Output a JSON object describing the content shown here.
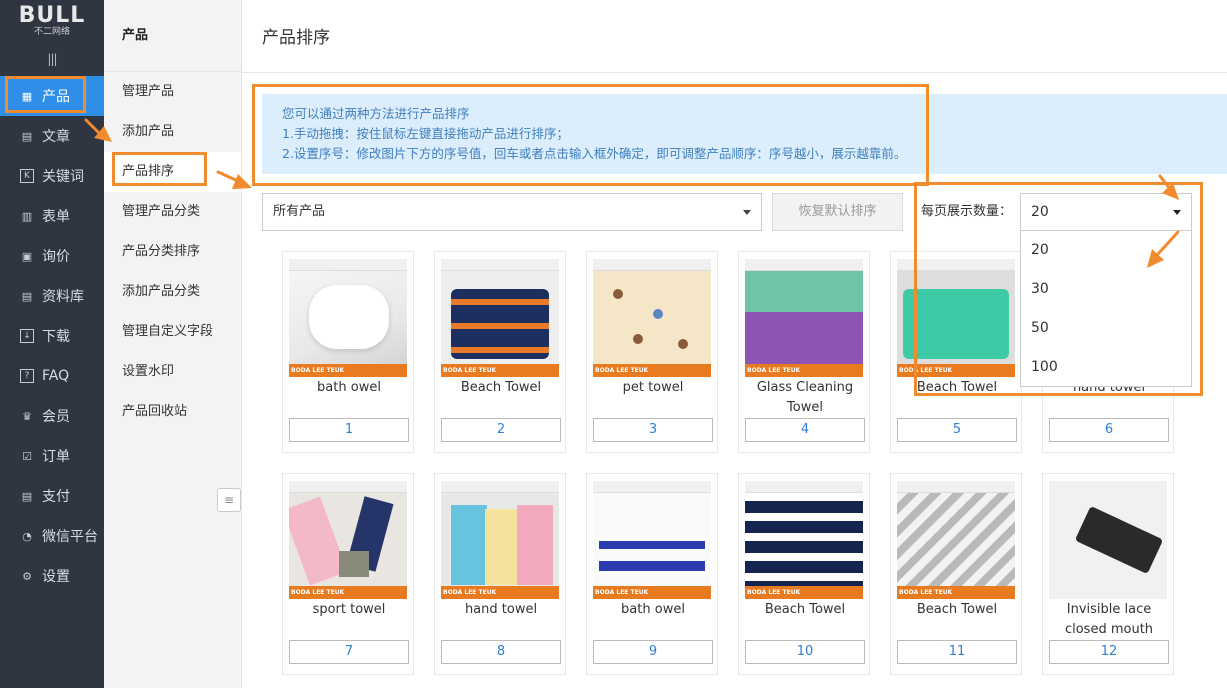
{
  "logo": {
    "brand": "BULL",
    "sub": "不二网络"
  },
  "sidebar": {
    "collapse_glyph": "|||",
    "items": [
      {
        "label": "产品",
        "icon": "grid-icon",
        "glyph": "▦",
        "active": true
      },
      {
        "label": "文章",
        "icon": "document-icon",
        "glyph": "▤"
      },
      {
        "label": "关键词",
        "icon": "keyword-icon",
        "glyph": "K"
      },
      {
        "label": "表单",
        "icon": "form-icon",
        "glyph": "▥"
      },
      {
        "label": "询价",
        "icon": "inquiry-icon",
        "glyph": "▣"
      },
      {
        "label": "资料库",
        "icon": "database-icon",
        "glyph": "▤"
      },
      {
        "label": "下载",
        "icon": "download-icon",
        "glyph": "↓"
      },
      {
        "label": "FAQ",
        "icon": "question-icon",
        "glyph": "?"
      },
      {
        "label": "会员",
        "icon": "crown-icon",
        "glyph": "♛"
      },
      {
        "label": "订单",
        "icon": "order-icon",
        "glyph": "☑"
      },
      {
        "label": "支付",
        "icon": "payment-icon",
        "glyph": "▤"
      },
      {
        "label": "微信平台",
        "icon": "wechat-icon",
        "glyph": "◔"
      },
      {
        "label": "设置",
        "icon": "gear-icon",
        "glyph": "⚙"
      }
    ]
  },
  "submenu": {
    "title": "产品",
    "toggle_glyph": "≡",
    "items": [
      {
        "label": "管理产品"
      },
      {
        "label": "添加产品"
      },
      {
        "label": "产品排序",
        "active": true
      },
      {
        "label": "管理产品分类"
      },
      {
        "label": "产品分类排序"
      },
      {
        "label": "添加产品分类"
      },
      {
        "label": "管理自定义字段"
      },
      {
        "label": "设置水印"
      },
      {
        "label": "产品回收站"
      }
    ]
  },
  "page": {
    "title": "产品排序"
  },
  "tip": {
    "line1": "您可以通过两种方法进行产品排序",
    "line2": "1.手动拖拽：按住鼠标左键直接拖动产品进行排序；",
    "line3": "2.设置序号：修改图片下方的序号值，回车或者点击输入框外确定，即可调整产品顺序：序号越小，展示越靠前。"
  },
  "filter": {
    "value": "所有产品"
  },
  "reset_button": "恢复默认排序",
  "per_page": {
    "label": "每页展示数量：",
    "value": "20",
    "options": [
      "20",
      "30",
      "50",
      "100"
    ]
  },
  "products": [
    {
      "name": "bath owel",
      "seq": "1",
      "brand_label": "BODA LEE TEUK"
    },
    {
      "name": "Beach Towel",
      "seq": "2",
      "brand_label": "BODA LEE TEUK"
    },
    {
      "name": "pet towel",
      "seq": "3",
      "brand_label": "BODA LEE TEUK"
    },
    {
      "name": "Glass Cleaning Towel",
      "seq": "4",
      "brand_label": "BODA LEE TEUK"
    },
    {
      "name": "Beach Towel",
      "seq": "5",
      "brand_label": "BODA LEE TEUK"
    },
    {
      "name": "hand towel",
      "seq": "6",
      "brand_label": ""
    },
    {
      "name": "sport towel",
      "seq": "7",
      "brand_label": "BODA LEE TEUK"
    },
    {
      "name": "hand towel",
      "seq": "8",
      "brand_label": "BODA LEE TEUK"
    },
    {
      "name": "bath owel",
      "seq": "9",
      "brand_label": "BODA LEE TEUK"
    },
    {
      "name": "Beach Towel",
      "seq": "10",
      "brand_label": "BODA LEE TEUK"
    },
    {
      "name": "Beach Towel",
      "seq": "11",
      "brand_label": "BODA LEE TEUK"
    },
    {
      "name": "Invisible lace closed mouth",
      "seq": "12",
      "brand_label": ""
    }
  ],
  "colors": {
    "accent": "#2e8ee8",
    "annotation": "#f28a2e",
    "sidebar_bg": "#2f3541",
    "tip_bg": "#dceefc"
  }
}
